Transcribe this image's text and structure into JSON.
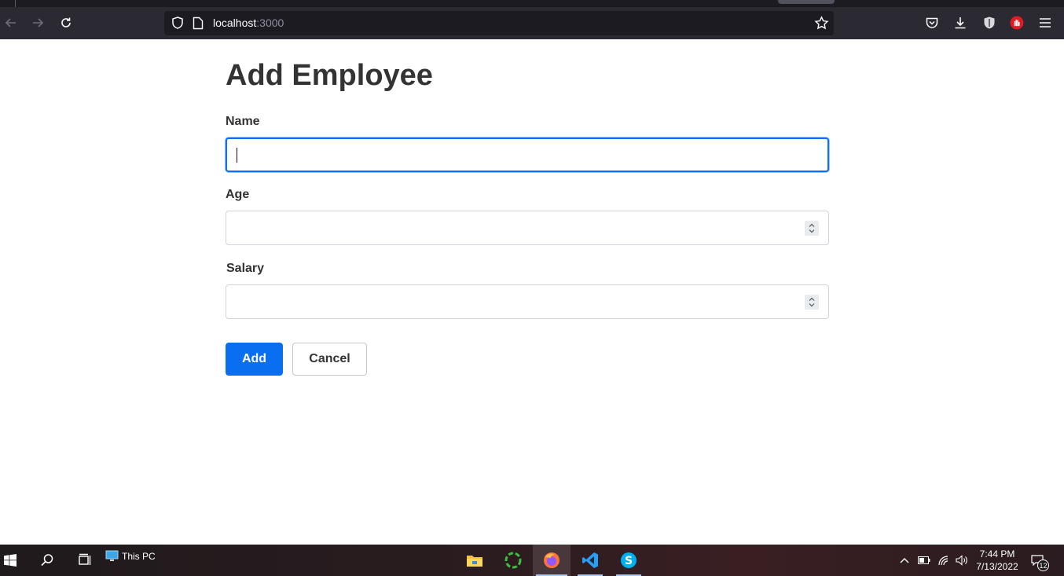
{
  "browser": {
    "url_host": "localhost",
    "url_port": ":3000"
  },
  "form": {
    "title": "Add Employee",
    "name_label": "Name",
    "name_value": "",
    "age_label": "Age",
    "age_value": "",
    "salary_label": "Salary",
    "salary_value": "",
    "add_label": "Add",
    "cancel_label": "Cancel"
  },
  "taskbar": {
    "this_pc_label": "This PC",
    "time": "7:44 PM",
    "date": "7/13/2022",
    "notification_count": "12",
    "pinned_apps": [
      "file-explorer",
      "sync-app",
      "firefox",
      "vscode",
      "skype"
    ]
  },
  "colors": {
    "accent": "#0a6ef0",
    "focus_ring": "#0d6efd",
    "text": "#333333",
    "browser_toolbar": "#2b2a33"
  }
}
